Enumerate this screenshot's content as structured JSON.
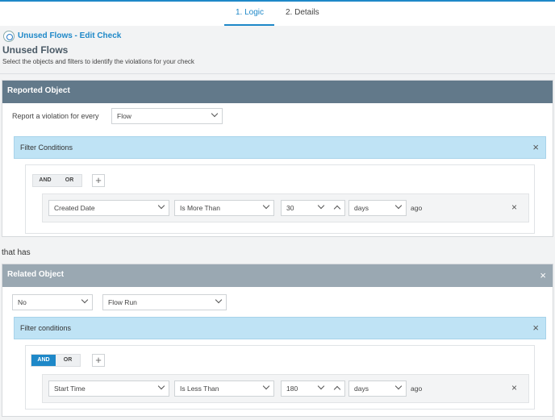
{
  "tabs": [
    {
      "label": "1. Logic",
      "active": true
    },
    {
      "label": "2. Details",
      "active": false
    }
  ],
  "header": {
    "breadcrumb": "Unused Flows - Edit Check",
    "title": "Unused Flows",
    "subtitle": "Select the objects and filters to identify the violations for your check"
  },
  "reported": {
    "heading": "Reported Object",
    "violation_label": "Report a violation for every",
    "object_value": "Flow",
    "filter": {
      "heading": "Filter Conditions",
      "and_label": "AND",
      "or_label": "OR",
      "active_logic": "none",
      "add_symbol": "+",
      "condition": {
        "field": "Created Date",
        "operator": "Is More Than",
        "amount": "30",
        "unit": "days",
        "suffix": "ago"
      }
    }
  },
  "connector_text": "that has",
  "related": {
    "heading": "Related Object",
    "quantifier": "No",
    "object_value": "Flow Run",
    "filter": {
      "heading": "Filter conditions",
      "and_label": "AND",
      "or_label": "OR",
      "active_logic": "AND",
      "add_symbol": "+",
      "condition": {
        "field": "Start Time",
        "operator": "Is Less Than",
        "amount": "180",
        "unit": "days",
        "suffix": "ago"
      }
    }
  },
  "icons": {
    "close": "×",
    "app": "flow-check-icon"
  },
  "colors": {
    "accent": "#1e88c8",
    "reported_header": "#62798a",
    "related_header": "#9aa8b2",
    "filter_header": "#bfe3f5"
  }
}
